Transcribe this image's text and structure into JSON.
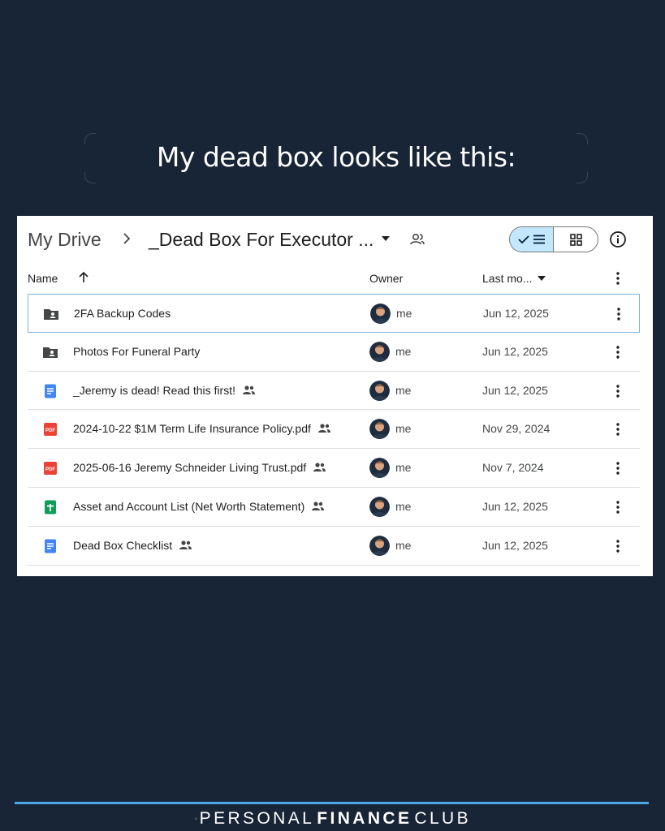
{
  "headline": "My dead box looks like this:",
  "drive": {
    "breadcrumb": {
      "root": "My Drive",
      "current": "_Dead Box For Executor ..."
    },
    "columns": {
      "name": "Name",
      "owner": "Owner",
      "last_modified": "Last mo..."
    },
    "files": [
      {
        "name": "2FA Backup Codes",
        "icon": "shared-folder-icon",
        "shared": false,
        "owner": "me",
        "date": "Jun 12, 2025",
        "selected": true
      },
      {
        "name": "Photos For Funeral Party",
        "icon": "shared-folder-icon",
        "shared": false,
        "owner": "me",
        "date": "Jun 12, 2025",
        "selected": false
      },
      {
        "name": "_Jeremy is dead! Read this first!",
        "icon": "google-docs-icon",
        "shared": true,
        "owner": "me",
        "date": "Jun 12, 2025",
        "selected": false
      },
      {
        "name": "2024-10-22 $1M Term Life Insurance Policy.pdf",
        "icon": "pdf-icon",
        "shared": true,
        "owner": "me",
        "date": "Nov 29, 2024",
        "selected": false
      },
      {
        "name": "2025-06-16 Jeremy Schneider Living Trust.pdf",
        "icon": "pdf-icon",
        "shared": true,
        "owner": "me",
        "date": "Nov 7, 2024",
        "selected": false
      },
      {
        "name": "Asset and Account List (Net Worth Statement)",
        "icon": "google-sheets-icon",
        "shared": true,
        "owner": "me",
        "date": "Jun 12, 2025",
        "selected": false
      },
      {
        "name": "Dead Box Checklist",
        "icon": "google-docs-icon",
        "shared": true,
        "owner": "me",
        "date": "Jun 12, 2025",
        "selected": false
      }
    ]
  },
  "footer": {
    "brand_light_1": "PERSONAL",
    "brand_bold": "FINANCE",
    "brand_light_2": "CLUB"
  },
  "colors": {
    "background": "#182536",
    "accent": "#4fa8e6",
    "selected_toggle": "#c2e7ff",
    "pdf_red": "#ea4335",
    "docs_blue": "#4285f4",
    "sheets_green": "#0f9d58"
  }
}
